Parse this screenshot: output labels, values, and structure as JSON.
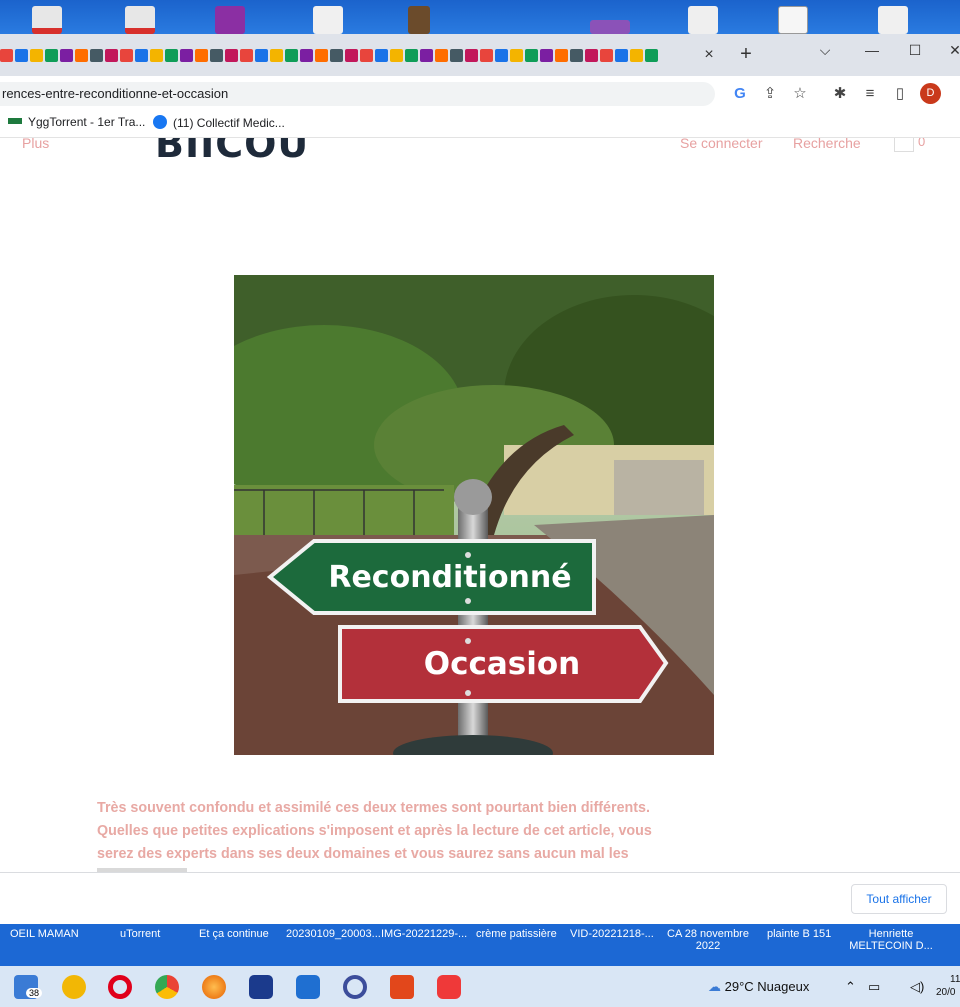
{
  "browser": {
    "url": "rences-entre-reconditionne-et-occasion",
    "tab_close": "×",
    "new_tab": "+",
    "controls": {
      "dropdown": "⌵",
      "minimize": "—",
      "maximize": "☐",
      "close": "✕"
    },
    "profile_initial": "D",
    "toolbar_icons": [
      "google-icon",
      "share-icon",
      "star-icon",
      "extensions-icon",
      "reading-list-icon",
      "side-panel-icon"
    ]
  },
  "bookmarks": [
    {
      "label": "YggTorrent - 1er Tra...",
      "icon": "ygg-icon"
    },
    {
      "label": "(11) Collectif Medic...",
      "icon": "facebook-icon"
    }
  ],
  "site": {
    "nav_more": "Plus",
    "logo": "BIICOU",
    "login": "Se connecter",
    "search": "Recherche",
    "cart_count": "0"
  },
  "hero": {
    "sign_top": "Reconditionné",
    "sign_bottom": "Occasion",
    "colors": {
      "green": "#1c6a3c",
      "red": "#b3303a"
    }
  },
  "article": {
    "intro": "Très souvent confondu et assimilé ces deux termes sont pourtant bien différents. Quelles que petites explications s'imposent et après la lecture de cet article, vous serez des experts dans ses deux domaines et vous saurez sans aucun mal les identifier."
  },
  "downloads": {
    "show_all": "Tout afficher"
  },
  "desktop_labels": [
    "OEIL MAMAN",
    "uTorrent",
    "Et ça continue",
    "20230109_20003...",
    "IMG-20221229-...",
    "crème patissière",
    "VID-20221218-...",
    "CA 28 novembre 2022",
    "plainte B 151",
    "Henriette MELTECOIN D..."
  ],
  "taskbar": {
    "mail_badge": "38",
    "weather": "29°C  Nuageux",
    "time": "11",
    "date": "20/0"
  }
}
